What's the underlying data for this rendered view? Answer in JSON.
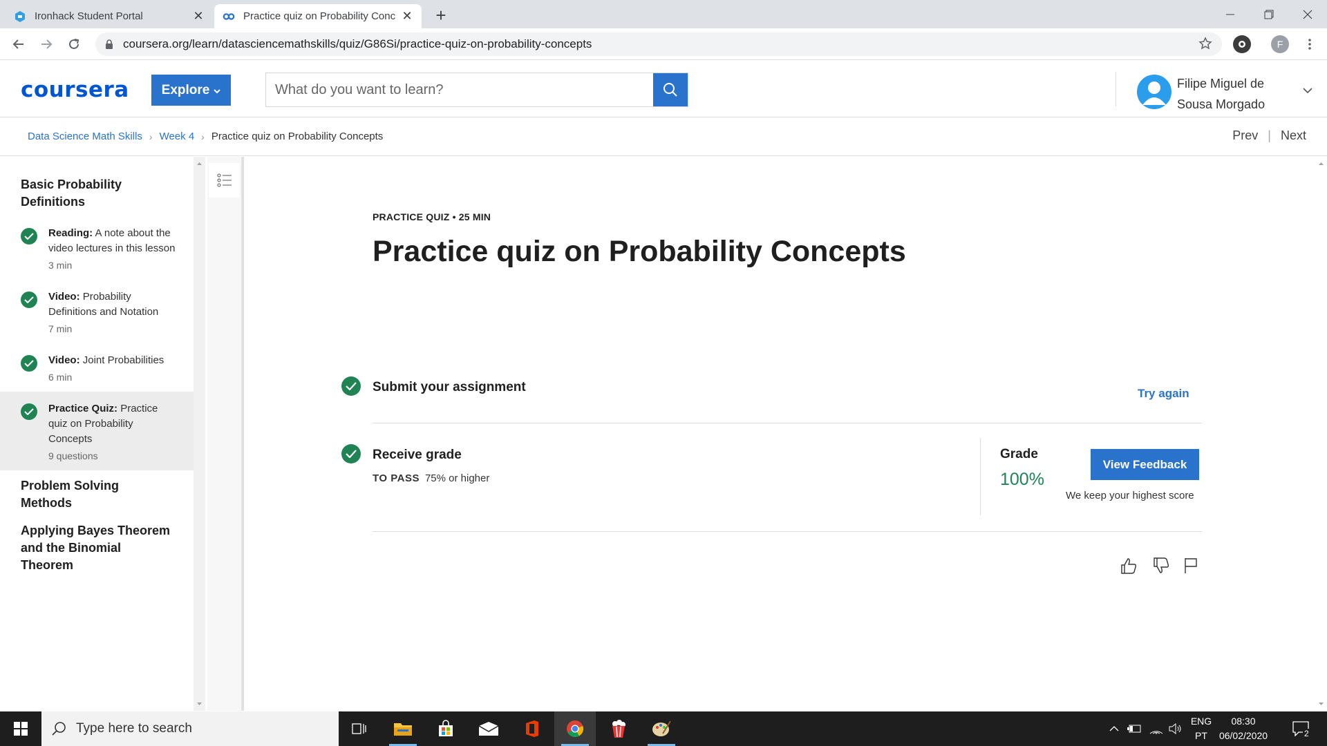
{
  "browser": {
    "tabs": [
      {
        "title": "Ironhack Student Portal"
      },
      {
        "title": "Practice quiz on Probability Conc"
      }
    ],
    "url": "coursera.org/learn/datasciencemathskills/quiz/G86Si/practice-quiz-on-probability-concepts",
    "profile_initial": "F"
  },
  "header": {
    "logo": "coursera",
    "explore_label": "Explore",
    "search_placeholder": "What do you want to learn?",
    "user_name_line1": "Filipe Miguel de",
    "user_name_line2": "Sousa Morgado"
  },
  "breadcrumb": {
    "items": [
      "Data Science Math Skills",
      "Week 4"
    ],
    "current": "Practice quiz on Probability Concepts",
    "prev": "Prev",
    "next": "Next",
    "sep": "|"
  },
  "sidebar": {
    "section1": "Basic Probability Definitions",
    "items": [
      {
        "kind": "Reading:",
        "title": "A note about the video lectures in this lesson",
        "meta": "3 min"
      },
      {
        "kind": "Video:",
        "title": "Probability Definitions and Notation",
        "meta": "7 min"
      },
      {
        "kind": "Video:",
        "title": "Joint Probabilities",
        "meta": "6 min"
      },
      {
        "kind": "Practice Quiz:",
        "title": "Practice quiz on Probability Concepts",
        "meta": "9 questions"
      }
    ],
    "section2": "Problem Solving Methods",
    "section3": "Applying Bayes Theorem and the Binomial Theorem"
  },
  "main": {
    "kicker": "PRACTICE QUIZ • 25 MIN",
    "title": "Practice quiz on Probability Concepts",
    "submit_label": "Submit your assignment",
    "try_again": "Try again",
    "receive_label": "Receive grade",
    "to_pass_label": "TO PASS",
    "to_pass_value": "75% or higher",
    "grade_label": "Grade",
    "grade_value": "100%",
    "feedback_button": "View Feedback",
    "keep_note": "We keep your highest score"
  },
  "taskbar": {
    "search_placeholder": "Type here to search",
    "lang_line1": "ENG",
    "lang_line2": "PT",
    "time": "08:30",
    "date": "06/02/2020",
    "notifications": "2"
  },
  "colors": {
    "brand_blue": "#2a73cc",
    "success_green": "#1f8354"
  }
}
